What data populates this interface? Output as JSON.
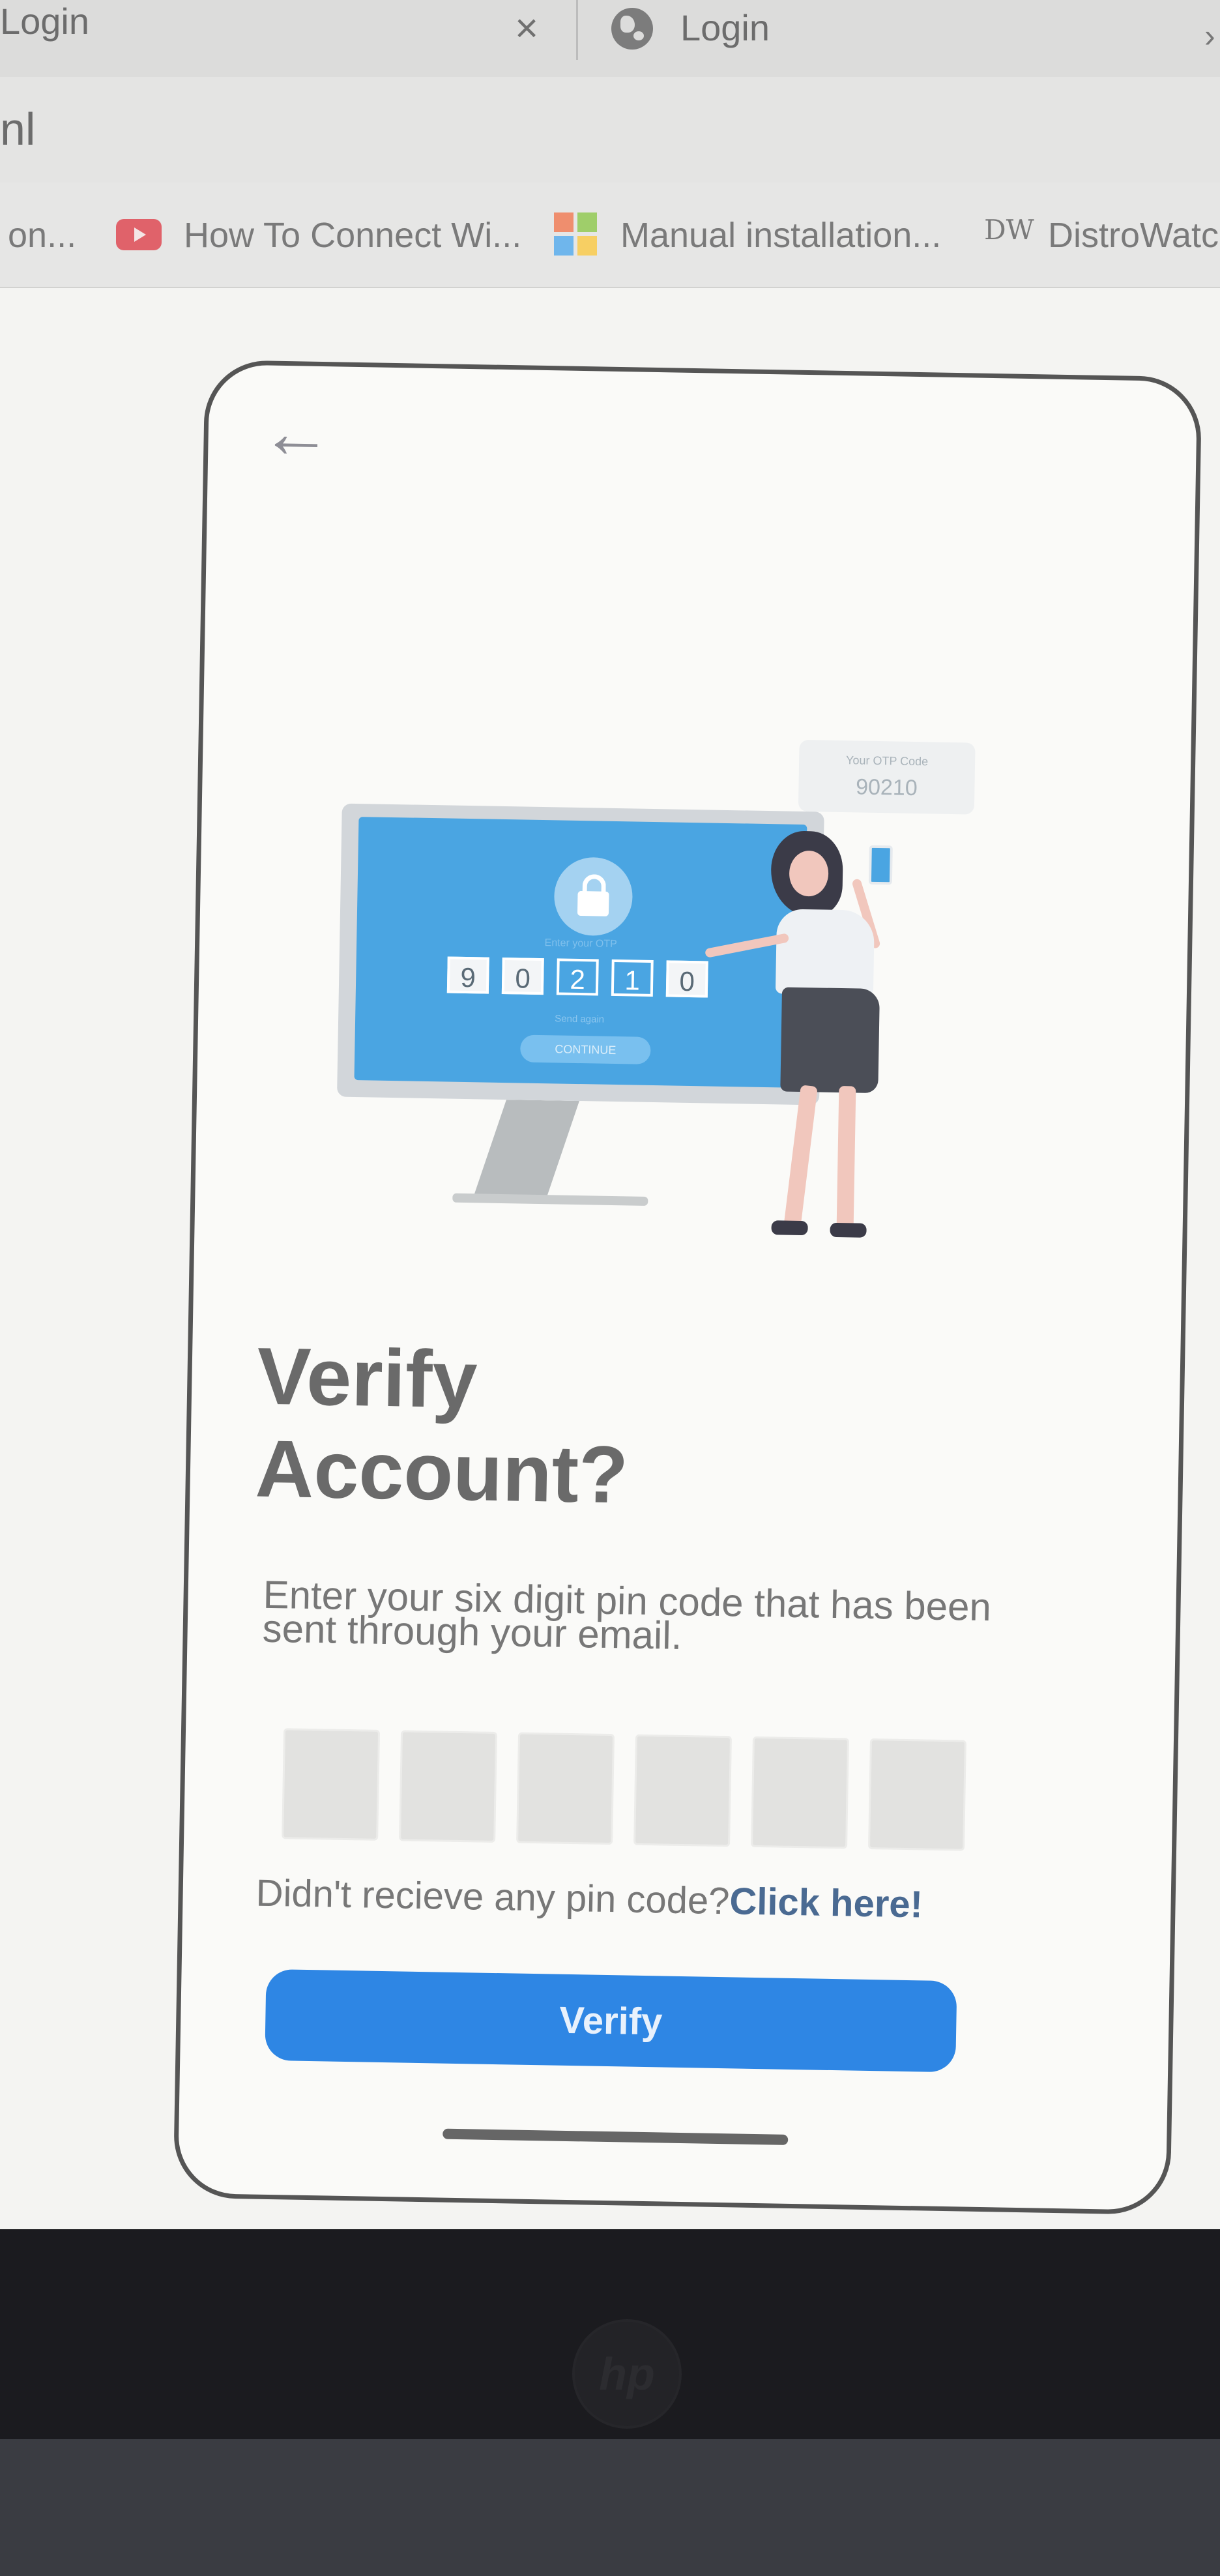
{
  "browser": {
    "tab1_title": "Login",
    "tab2_title": "Login",
    "tab_close": "×",
    "tab_more": "›",
    "url_fragment": "nl",
    "bookmarks": [
      {
        "label": "on..."
      },
      {
        "label": "How To Connect Wi..."
      },
      {
        "label": "Manual installation..."
      },
      {
        "label": "DistroWatc"
      }
    ],
    "distrowatch_icon": "DW"
  },
  "illustration": {
    "otp_bubble_caption": "Your OTP Code",
    "otp_bubble_value": "90210",
    "screen_label": "Enter your OTP",
    "digits": [
      "9",
      "0",
      "2",
      "1",
      "0"
    ],
    "send_again": "Send again",
    "continue_label": "CONTINUE"
  },
  "app": {
    "back_icon": "arrow-left-icon",
    "title_line1": "Verify",
    "title_line2": "Account?",
    "description": "Enter your six digit pin code that has been sent through your email.",
    "pin_length": 6,
    "resend_prompt": "Didn't recieve any pin code?",
    "resend_link": "Click here!",
    "verify_label": "Verify"
  },
  "colors": {
    "accent": "#2e86e4",
    "link": "#4a6a92"
  },
  "laptop_logo": "hp"
}
